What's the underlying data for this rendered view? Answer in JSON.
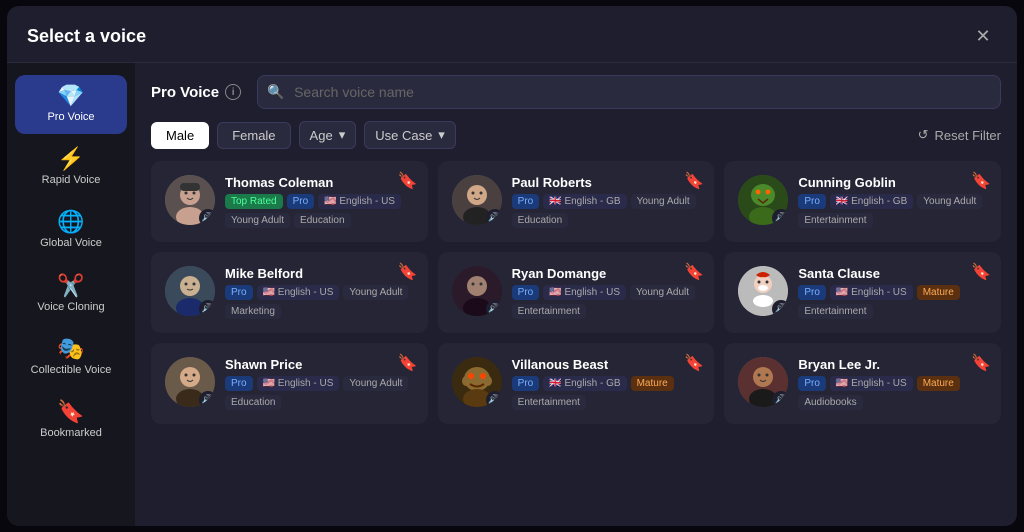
{
  "modal": {
    "title": "Select a voice",
    "close_label": "✕"
  },
  "sidebar": {
    "items": [
      {
        "id": "pro-voice",
        "label": "Pro Voice",
        "icon": "💎",
        "active": true
      },
      {
        "id": "rapid-voice",
        "label": "Rapid Voice",
        "icon": "⚡",
        "active": false
      },
      {
        "id": "global-voice",
        "label": "Global Voice",
        "icon": "🌐",
        "active": false
      },
      {
        "id": "voice-cloning",
        "label": "Voice Cloning",
        "icon": "✂️",
        "active": false
      },
      {
        "id": "collectible-voice",
        "label": "Collectible Voice",
        "icon": "🎭",
        "active": false
      },
      {
        "id": "bookmarked",
        "label": "Bookmarked",
        "icon": "🔖",
        "active": false
      }
    ]
  },
  "header": {
    "pro_voice_label": "Pro Voice",
    "info_icon": "i",
    "search_placeholder": "Search voice name"
  },
  "filters": {
    "male_label": "Male",
    "female_label": "Female",
    "age_label": "Age",
    "use_case_label": "Use Case",
    "reset_label": "Reset Filter"
  },
  "voices": [
    {
      "name": "Thomas Coleman",
      "tags": [
        {
          "text": "Top Rated",
          "type": "green"
        },
        {
          "text": "Pro",
          "type": "blue"
        },
        {
          "text": "🇺🇸 English - US",
          "type": "lang"
        },
        {
          "text": "Young Adult",
          "type": "gray"
        },
        {
          "text": "Education",
          "type": "gray"
        }
      ],
      "avatar_class": "av-thomas",
      "avatar_emoji": "👨"
    },
    {
      "name": "Paul Roberts",
      "tags": [
        {
          "text": "Pro",
          "type": "blue"
        },
        {
          "text": "🇬🇧 English - GB",
          "type": "lang"
        },
        {
          "text": "Young Adult",
          "type": "gray"
        },
        {
          "text": "Education",
          "type": "gray"
        }
      ],
      "avatar_class": "av-paul",
      "avatar_emoji": "👨‍💼"
    },
    {
      "name": "Cunning Goblin",
      "tags": [
        {
          "text": "Pro",
          "type": "blue"
        },
        {
          "text": "🇬🇧 English - GB",
          "type": "lang"
        },
        {
          "text": "Young Adult",
          "type": "gray"
        },
        {
          "text": "Entertainment",
          "type": "gray"
        }
      ],
      "avatar_class": "av-goblin",
      "avatar_emoji": "👺"
    },
    {
      "name": "Mike Belford",
      "tags": [
        {
          "text": "Pro",
          "type": "blue"
        },
        {
          "text": "🇺🇸 English - US",
          "type": "lang"
        },
        {
          "text": "Young Adult",
          "type": "gray"
        },
        {
          "text": "Marketing",
          "type": "gray"
        }
      ],
      "avatar_class": "av-mike",
      "avatar_emoji": "👨‍💻"
    },
    {
      "name": "Ryan Domange",
      "tags": [
        {
          "text": "Pro",
          "type": "blue"
        },
        {
          "text": "🇺🇸 English - US",
          "type": "lang"
        },
        {
          "text": "Young Adult",
          "type": "gray"
        },
        {
          "text": "Entertainment",
          "type": "gray"
        }
      ],
      "avatar_class": "av-ryan",
      "avatar_emoji": "🧑"
    },
    {
      "name": "Santa Clause",
      "tags": [
        {
          "text": "Pro",
          "type": "blue"
        },
        {
          "text": "🇺🇸 English - US",
          "type": "lang"
        },
        {
          "text": "Mature",
          "type": "orange"
        },
        {
          "text": "Entertainment",
          "type": "gray"
        }
      ],
      "avatar_class": "av-santa",
      "avatar_emoji": "🎅"
    },
    {
      "name": "Shawn Price",
      "tags": [
        {
          "text": "Pro",
          "type": "blue"
        },
        {
          "text": "🇺🇸 English - US",
          "type": "lang"
        },
        {
          "text": "Young Adult",
          "type": "gray"
        },
        {
          "text": "Education",
          "type": "gray"
        }
      ],
      "avatar_class": "av-shawn",
      "avatar_emoji": "👱"
    },
    {
      "name": "Villanous Beast",
      "tags": [
        {
          "text": "Pro",
          "type": "blue"
        },
        {
          "text": "🇬🇧 English - GB",
          "type": "lang"
        },
        {
          "text": "Mature",
          "type": "orange"
        },
        {
          "text": "Entertainment",
          "type": "gray"
        }
      ],
      "avatar_class": "av-villanous",
      "avatar_emoji": "👹"
    },
    {
      "name": "Bryan Lee Jr.",
      "tags": [
        {
          "text": "Pro",
          "type": "blue"
        },
        {
          "text": "🇺🇸 English - US",
          "type": "lang"
        },
        {
          "text": "Mature",
          "type": "orange"
        },
        {
          "text": "Audiobooks",
          "type": "gray"
        }
      ],
      "avatar_class": "av-bryan",
      "avatar_emoji": "👨‍🦱"
    }
  ]
}
